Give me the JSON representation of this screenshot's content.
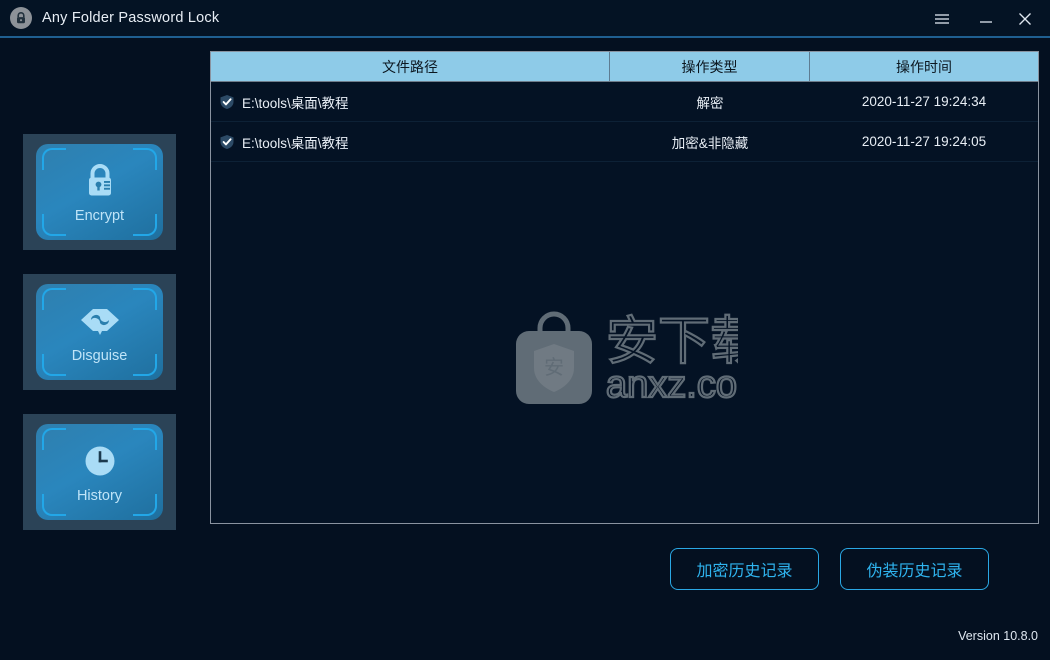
{
  "window": {
    "title": "Any Folder Password Lock",
    "logo_icon": "lock-badge-icon",
    "controls": {
      "menu": "menu-icon",
      "minimize": "minimize-icon",
      "close": "close-icon"
    }
  },
  "sidebar": {
    "items": [
      {
        "label": "Encrypt",
        "icon": "padlock-icon"
      },
      {
        "label": "Disguise",
        "icon": "mask-icon"
      },
      {
        "label": "History",
        "icon": "clock-icon"
      }
    ]
  },
  "table": {
    "columns": [
      "文件路径",
      "操作类型",
      "操作时间"
    ],
    "rows": [
      {
        "checked": true,
        "path": "E:\\tools\\桌面\\教程",
        "operation": "解密",
        "time": "2020-11-27 19:24:34"
      },
      {
        "checked": true,
        "path": "E:\\tools\\桌面\\教程",
        "operation": "加密&非隐藏",
        "time": "2020-11-27 19:24:05"
      }
    ],
    "row_check_icon": "shield-check-icon"
  },
  "watermark": {
    "icon": "bag-shield-icon",
    "text_cn": "安下载",
    "text_domain": "anxz.com"
  },
  "footer": {
    "buttons": [
      {
        "label": "加密历史记录"
      },
      {
        "label": "伪装历史记录"
      }
    ],
    "version": "Version 10.8.0"
  },
  "colors": {
    "background": "#041020",
    "titlebar": "#041324",
    "accent": "#2aa8e4",
    "header_row": "#8ecbe8",
    "panel": "#2b4357"
  }
}
